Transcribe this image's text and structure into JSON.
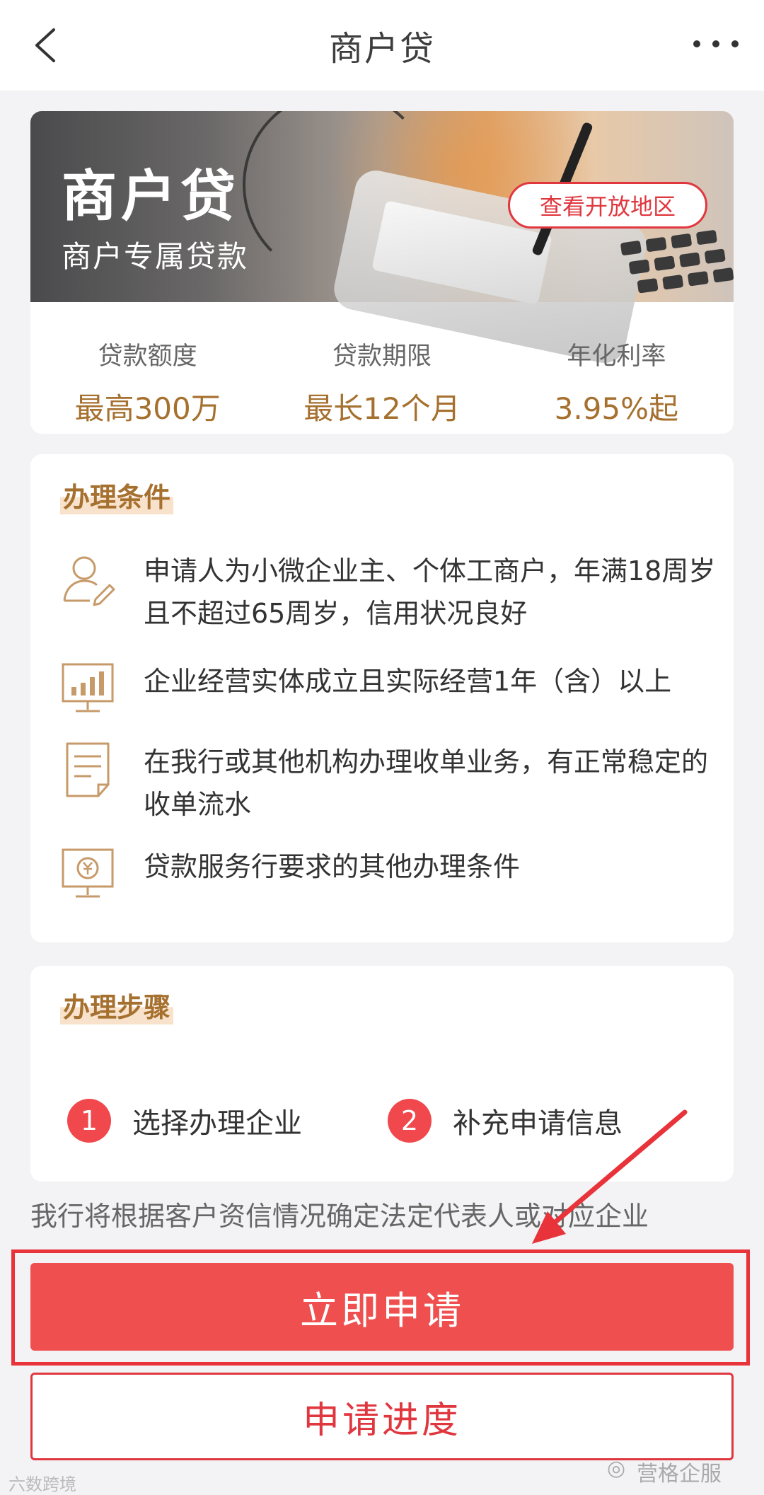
{
  "nav": {
    "title": "商户贷"
  },
  "banner": {
    "title": "商户贷",
    "subtitle": "商户专属贷款",
    "region_button": "查看开放地区"
  },
  "stats": [
    {
      "label": "贷款额度",
      "value": "最高300万"
    },
    {
      "label": "贷款期限",
      "value": "最长12个月"
    },
    {
      "label": "年化利率",
      "value": "3.95%起"
    }
  ],
  "conditions": {
    "title": "办理条件",
    "items": [
      {
        "icon": "person-edit-icon",
        "text": "申请人为小微企业主、个体工商户，年满18周岁且不超过65周岁，信用状况良好"
      },
      {
        "icon": "bar-chart-monitor-icon",
        "text": "企业经营实体成立且实际经营1年（含）以上"
      },
      {
        "icon": "document-icon",
        "text": "在我行或其他机构办理收单业务，有正常稳定的收单流水"
      },
      {
        "icon": "currency-monitor-icon",
        "text": "贷款服务行要求的其他办理条件"
      }
    ]
  },
  "steps": {
    "title": "办理步骤",
    "items": [
      {
        "num": "1",
        "label": "选择办理企业"
      },
      {
        "num": "2",
        "label": "补充申请信息"
      }
    ]
  },
  "notice": "我行将根据客户资信情况确定法定代表人或对应企业",
  "buttons": {
    "apply": "立即申请",
    "progress": "申请进度"
  },
  "watermarks": {
    "left": "六数跨境",
    "right": "营格企服"
  },
  "colors": {
    "accent_red": "#f04f4f",
    "gold": "#a6702f"
  }
}
